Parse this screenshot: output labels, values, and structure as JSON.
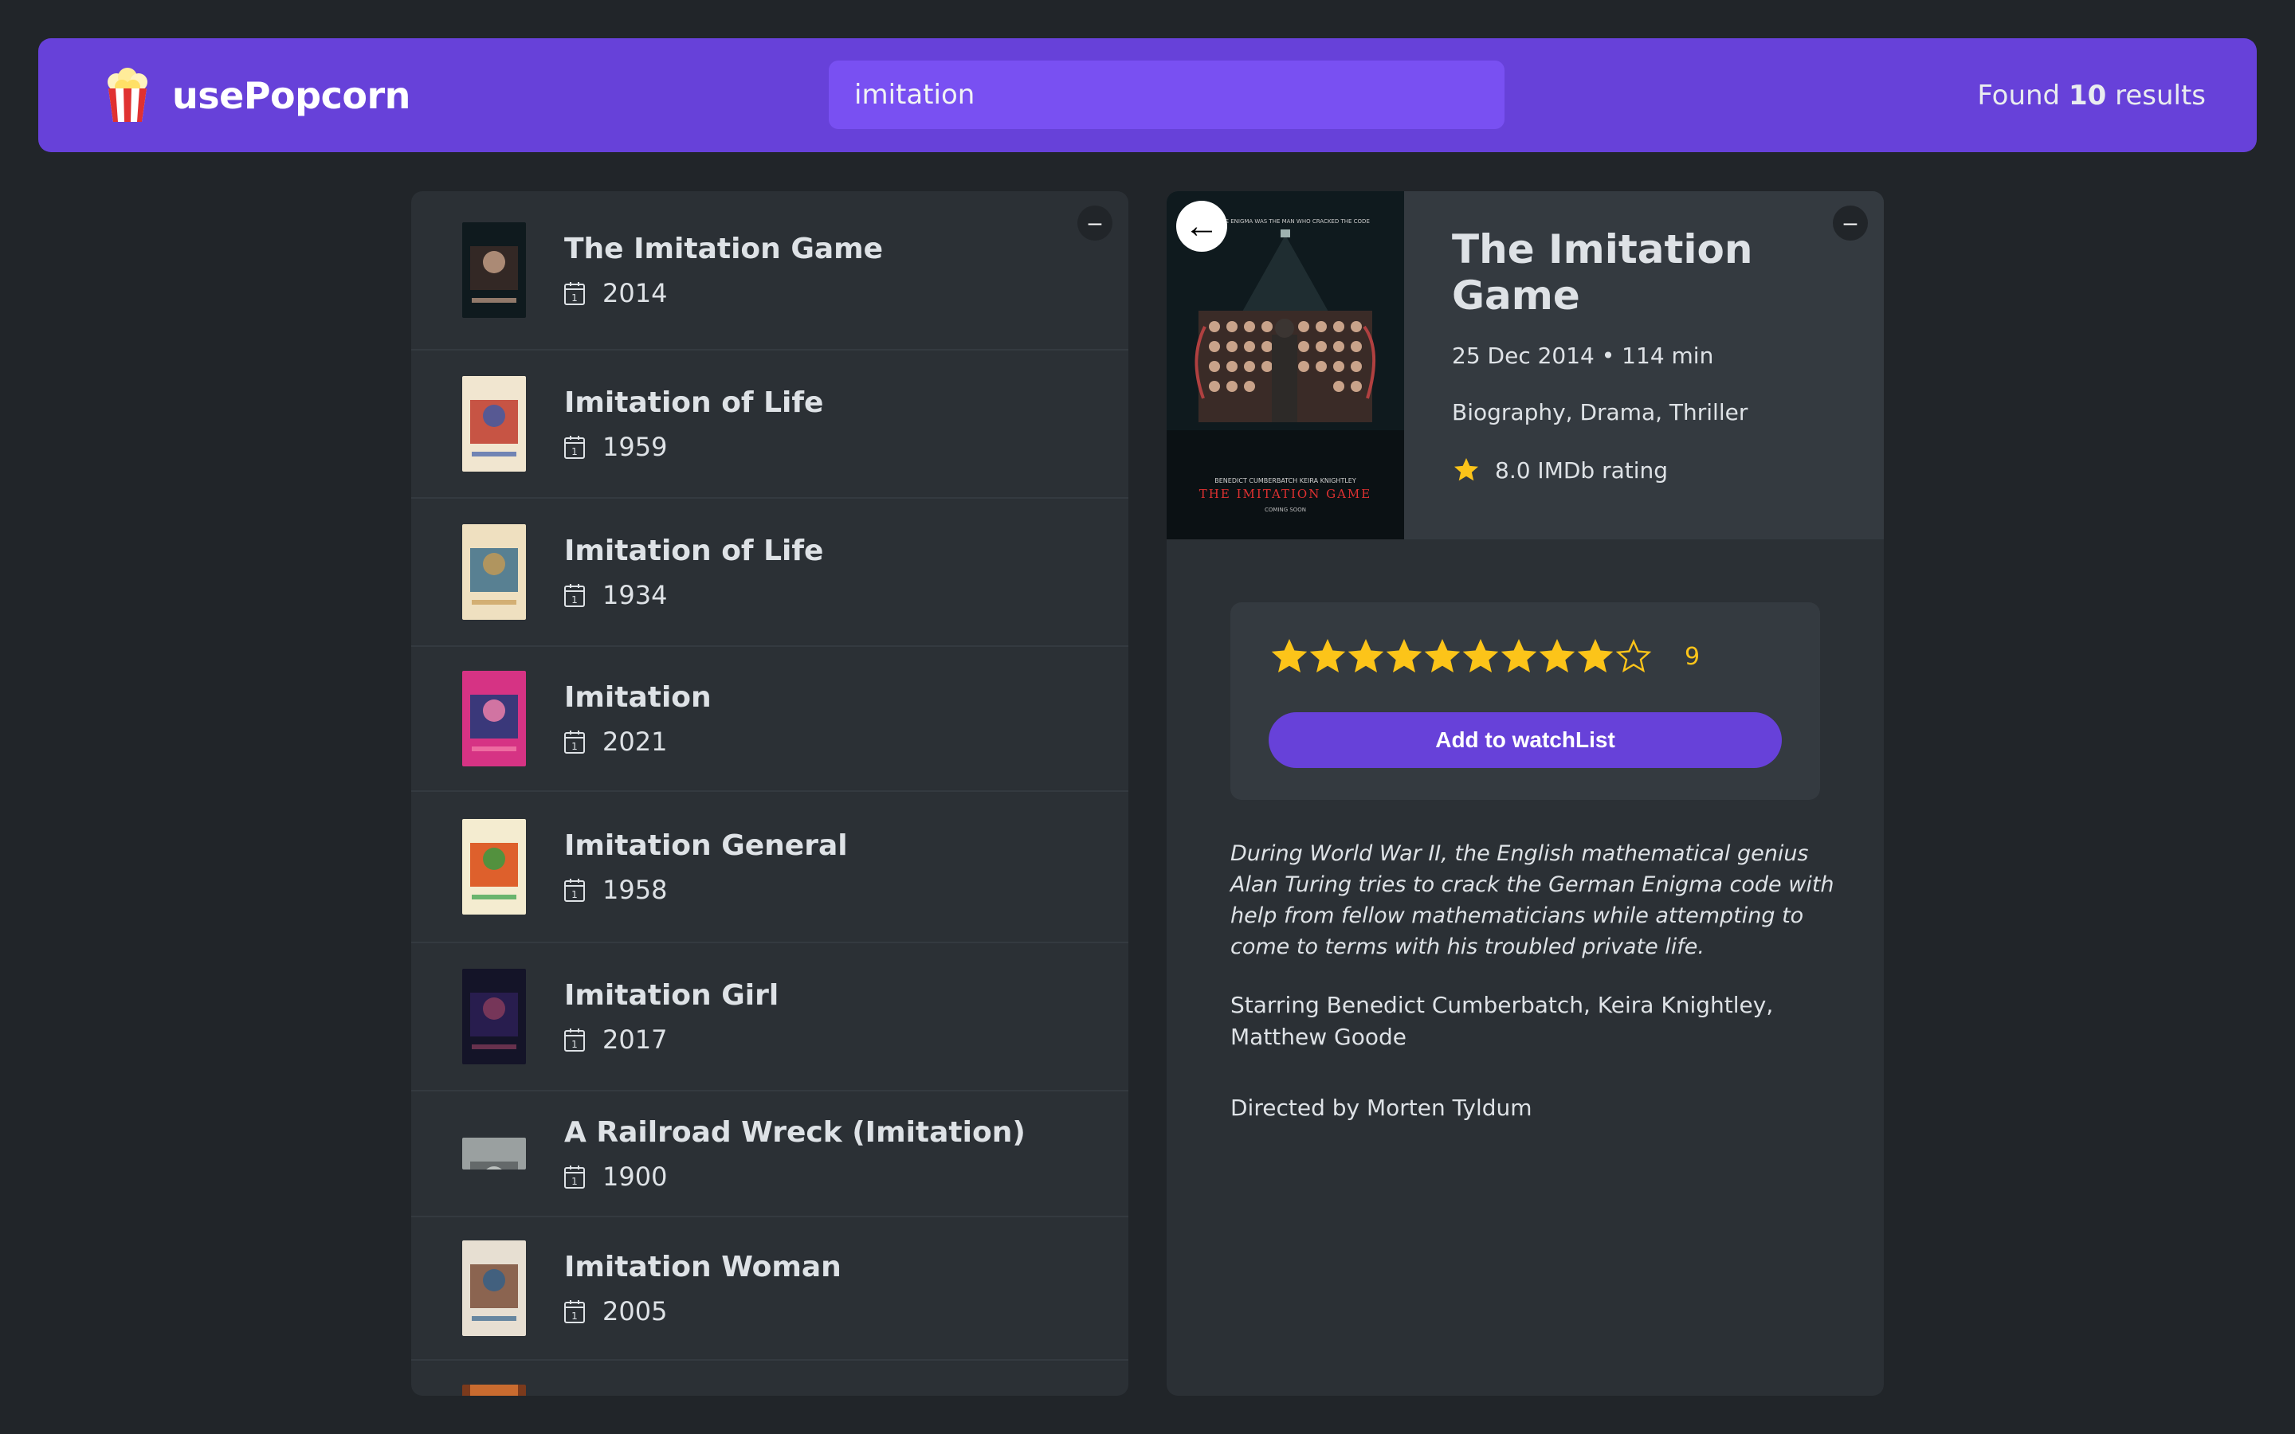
{
  "navbar": {
    "logo_text": "usePopcorn",
    "search_value": "imitation",
    "results_prefix": "Found",
    "results_count": "10",
    "results_suffix": "results"
  },
  "list": {
    "toggle_label": "–",
    "movies": [
      {
        "title": "The Imitation Game",
        "year": "2014"
      },
      {
        "title": "Imitation of Life",
        "year": "1959"
      },
      {
        "title": "Imitation of Life",
        "year": "1934"
      },
      {
        "title": "Imitation",
        "year": "2021"
      },
      {
        "title": "Imitation General",
        "year": "1958"
      },
      {
        "title": "Imitation Girl",
        "year": "2017"
      },
      {
        "title": "A Railroad Wreck (Imitation)",
        "year": "1900"
      },
      {
        "title": "Imitation Woman",
        "year": "2005"
      }
    ]
  },
  "details": {
    "toggle_label": "–",
    "back_label": "←",
    "title": "The Imitation Game",
    "released_runtime": "25 Dec 2014 • 114 min",
    "genre": "Biography, Drama, Thriller",
    "imdb_rating": "8.0 IMDb rating",
    "poster_top_text": "THE TRUE ENIGMA WAS THE MAN WHO CRACKED THE CODE",
    "poster_cast": "BENEDICT CUMBERBATCH    KEIRA KNIGHTLEY",
    "poster_title": "THE IMITATION GAME",
    "poster_coming": "COMING SOON",
    "user_rating": {
      "value": 9,
      "max": 10,
      "label": "9"
    },
    "add_button": "Add to watchList",
    "plot": "During World War II, the English mathematical genius Alan Turing tries to crack the German Enigma code with help from fellow mathematicians while attempting to come to terms with his troubled private life.",
    "starring": "Starring Benedict Cumberbatch, Keira Knightley, Matthew Goode",
    "director": "Directed by Morten Tyldum"
  },
  "colors": {
    "background": "#212529",
    "navbar": "#6741d9",
    "search": "#7950f2",
    "box": "#2b3035",
    "star": "#fcc419"
  }
}
